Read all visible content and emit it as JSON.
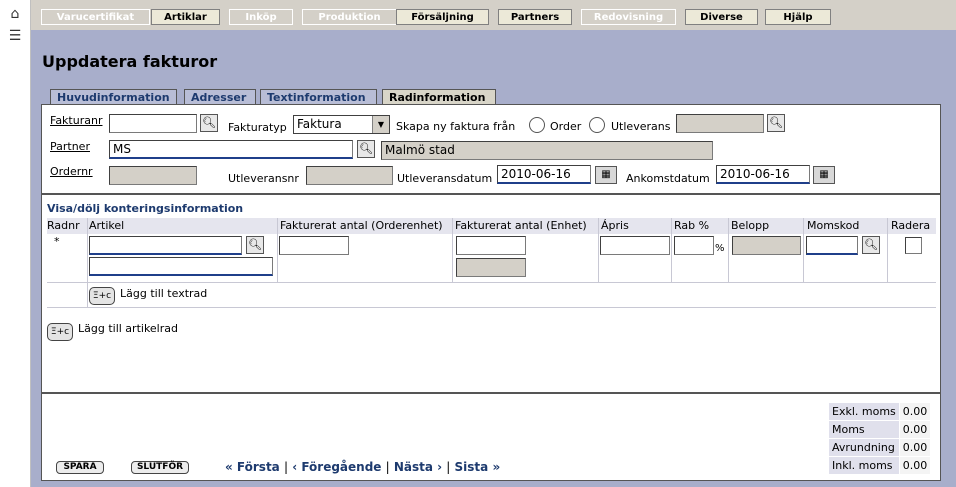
{
  "nav": {
    "tabs": [
      {
        "label": "Varucertifikat",
        "enabled": false
      },
      {
        "label": "Artiklar",
        "enabled": true
      },
      {
        "label": "Inköp",
        "enabled": false
      },
      {
        "label": "Produktion",
        "enabled": false
      },
      {
        "label": "Försäljning",
        "enabled": true
      },
      {
        "label": "Partners",
        "enabled": true
      },
      {
        "label": "Redovisning",
        "enabled": false
      },
      {
        "label": "Diverse",
        "enabled": true
      },
      {
        "label": "Hjälp",
        "enabled": true
      }
    ]
  },
  "page": {
    "title": "Uppdatera fakturor"
  },
  "subtabs": [
    {
      "label": "Huvudinformation",
      "active": false
    },
    {
      "label": "Adresser",
      "active": false
    },
    {
      "label": "Textinformation",
      "active": false
    },
    {
      "label": "Radinformation",
      "active": true
    }
  ],
  "header_form": {
    "fakturanr_label": "Fakturanr",
    "fakturanr_value": "",
    "fakturatyp_label": "Fakturatyp",
    "fakturatyp_value": "Faktura",
    "skapa_label": "Skapa ny faktura från",
    "order_label": "Order",
    "utleverans_label": "Utleverans",
    "partner_label": "Partner",
    "partner_value": "MS",
    "partner_name": "Malmö stad",
    "ordernr_label": "Ordernr",
    "utleveransnr_label": "Utleveransnr",
    "utleveransdatum_label": "Utleveransdatum",
    "utleveransdatum_value": "2010-06-16",
    "ankomstdatum_label": "Ankomstdatum",
    "ankomstdatum_value": "2010-06-16"
  },
  "rows_section": {
    "toggle_label": "Visa/dölj konteringsinformation",
    "columns": [
      "Radnr",
      "Artikel",
      "Fakturerat antal (Orderenhet)",
      "Fakturerat antal (Enhet)",
      "Ápris",
      "Rab %",
      "Belopp",
      "Momskod",
      "Radera"
    ],
    "new_row_marker": "*",
    "percent_sign": "%",
    "add_textrow_label": "Lägg till textrad",
    "add_articlerow_label": "Lägg till artikelrad",
    "textrow_icon_text": "Ξ+c",
    "articlerow_icon_text": "Ξ+c"
  },
  "footer": {
    "save_label": "SPARA",
    "finish_label": "SLUTFÖR",
    "first_label": "« Första",
    "prev_label": "‹ Föregående",
    "next_label": "Nästa ›",
    "last_label": "Sista »",
    "sep": "|"
  },
  "totals": [
    {
      "label": "Exkl. moms",
      "value": "0.00"
    },
    {
      "label": "Moms",
      "value": "0.00"
    },
    {
      "label": "Avrundning",
      "value": "0.00"
    },
    {
      "label": "Inkl. moms",
      "value": "0.00"
    }
  ],
  "icons": {
    "home": "home-icon",
    "list": "list-icon",
    "search": "search-icon",
    "calendar": "calendar-icon"
  },
  "colors": {
    "background": "#a8aecb",
    "link": "#1d3a6e",
    "topbar": "#d4d0c8"
  }
}
